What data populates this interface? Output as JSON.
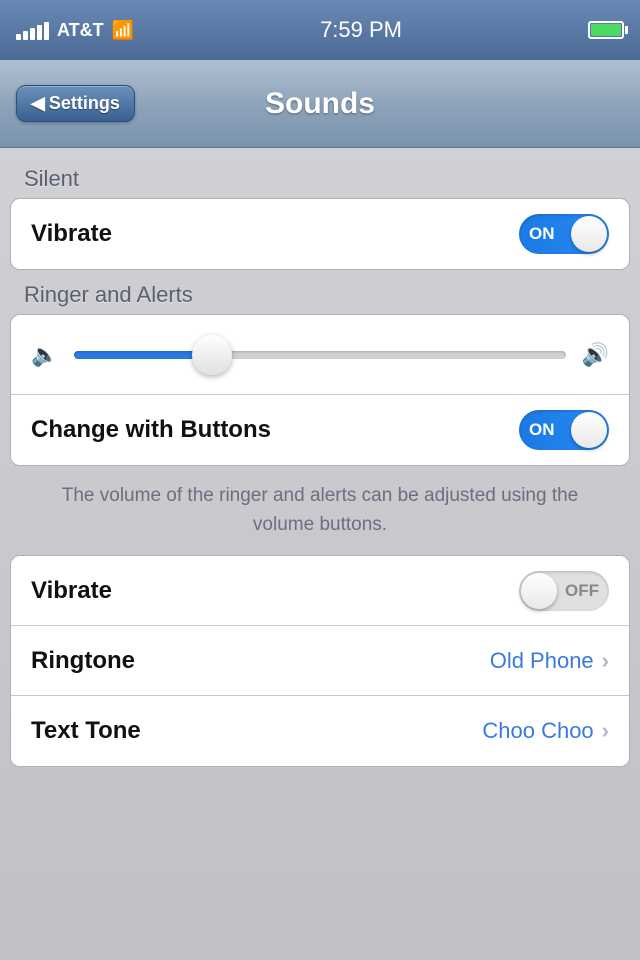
{
  "status_bar": {
    "carrier": "AT&T",
    "time": "7:59 PM",
    "battery_level": 90
  },
  "nav": {
    "back_label": "Settings",
    "title": "Sounds"
  },
  "sections": {
    "silent": {
      "header": "Silent",
      "rows": [
        {
          "label": "Vibrate",
          "toggle_state": "on",
          "toggle_label_on": "ON",
          "toggle_label_off": "OFF"
        }
      ]
    },
    "ringer": {
      "header": "Ringer and Alerts",
      "info_text": "The volume of the ringer and alerts can be adjusted using the volume buttons.",
      "change_with_buttons": {
        "label": "Change with Buttons",
        "toggle_state": "on",
        "toggle_label_on": "ON"
      },
      "volume": {
        "slider_percent": 30
      }
    },
    "more": {
      "rows": [
        {
          "label": "Vibrate",
          "toggle_state": "off",
          "toggle_label_off": "OFF"
        },
        {
          "label": "Ringtone",
          "value": "Old Phone",
          "arrow": "›"
        },
        {
          "label": "Text Tone",
          "value": "Choo Choo",
          "arrow": "›"
        }
      ]
    }
  }
}
